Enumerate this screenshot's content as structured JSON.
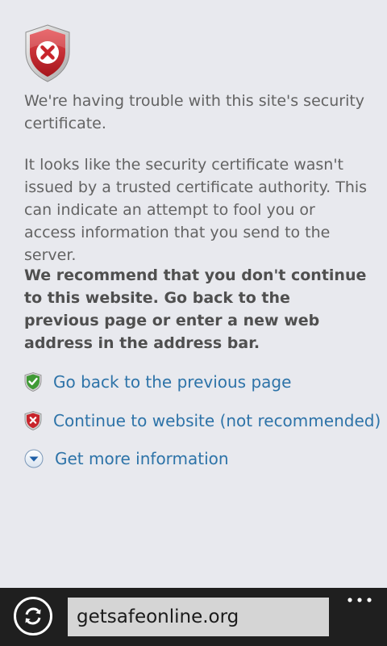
{
  "warning": {
    "icon": "shield-error-icon",
    "title": "We're having trouble with this site's security certificate.",
    "detail": "It looks like the security certificate wasn't issued by a trusted certificate authority. This can indicate an attempt to fool you or access information that you send to the server.",
    "recommendation": "We recommend that you don't continue to this website. Go back to the previous page or enter a new web address in the address bar."
  },
  "actions": [
    {
      "label": "Go back to the previous page",
      "icon": "shield-check-icon",
      "color": "#2d73a8"
    },
    {
      "label": "Continue to website (not recommended)",
      "icon": "shield-x-icon",
      "color": "#2d73a8"
    },
    {
      "label": "Get more information",
      "icon": "chevron-down-circle-icon",
      "color": "#2d73a8"
    }
  ],
  "app_bar": {
    "address": "getsafeonline.org",
    "refresh_icon": "refresh-icon",
    "more_icon": "more-dots-icon"
  },
  "colors": {
    "background": "#e8e9ee",
    "link": "#2d73a8",
    "shield_red": "#c8242b",
    "shield_green": "#3f9a35",
    "app_bar": "#1f1f1f"
  }
}
